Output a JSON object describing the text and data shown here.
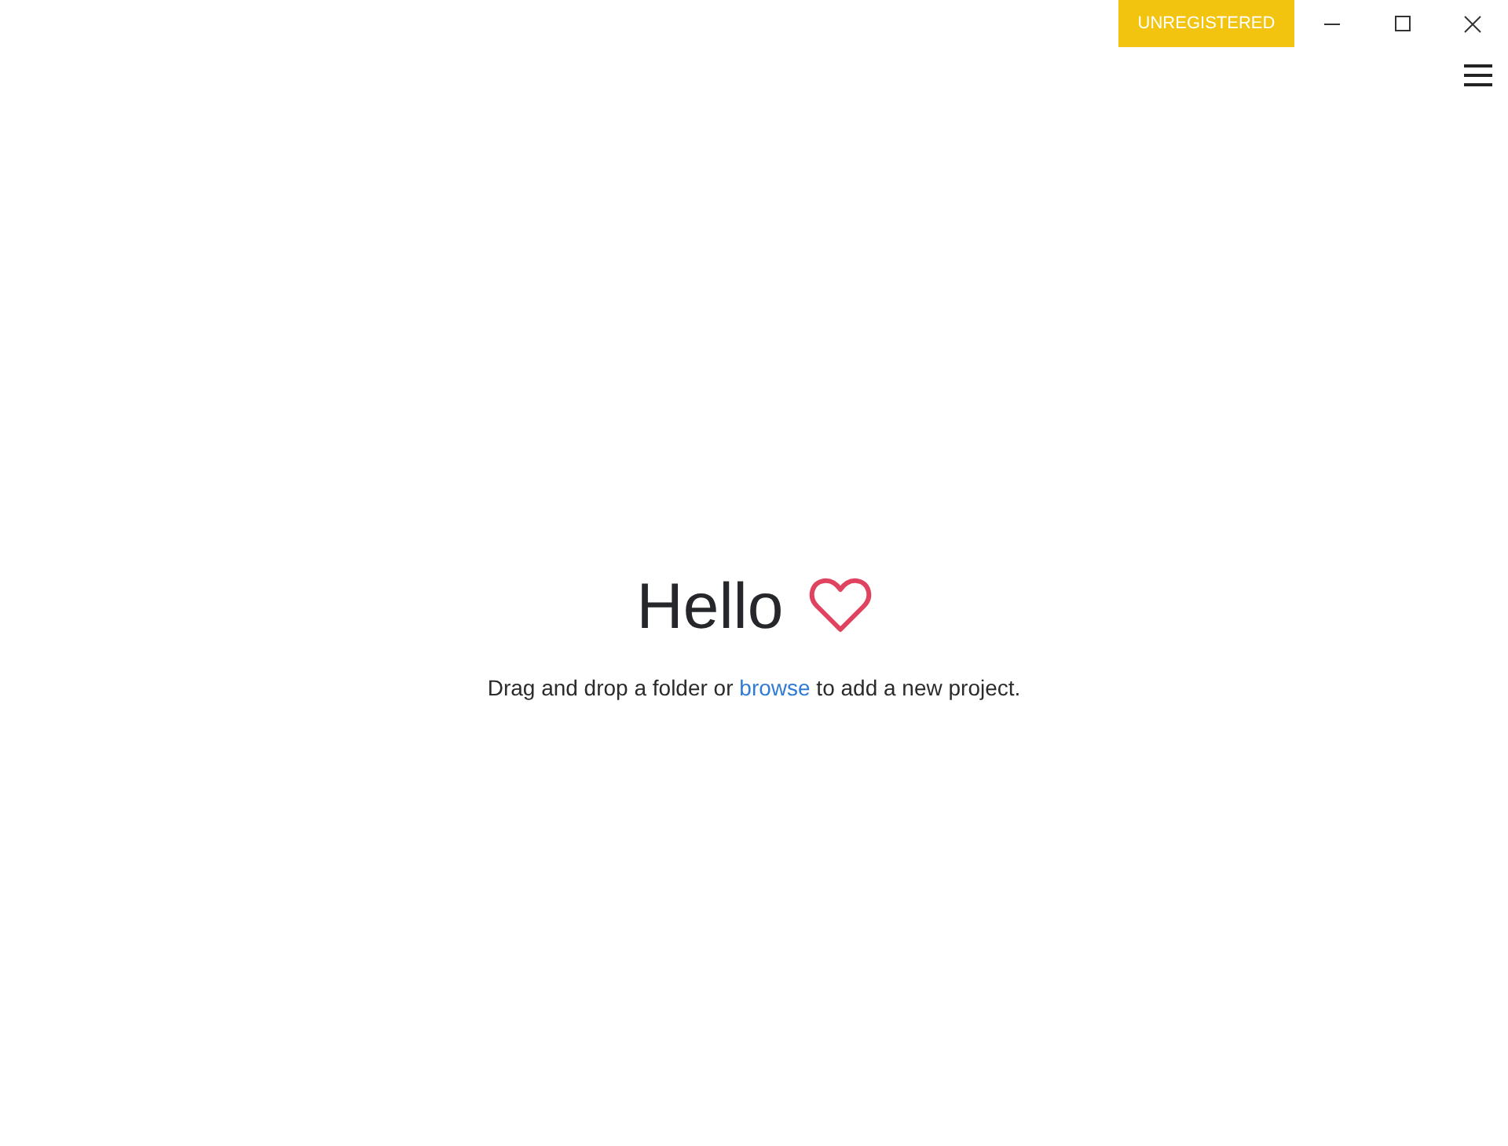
{
  "titlebar": {
    "badge": "UNREGISTERED"
  },
  "welcome": {
    "title": "Hello",
    "message": {
      "before": "Drag and drop a folder or ",
      "link": "browse",
      "after": " to add a new project."
    }
  }
}
